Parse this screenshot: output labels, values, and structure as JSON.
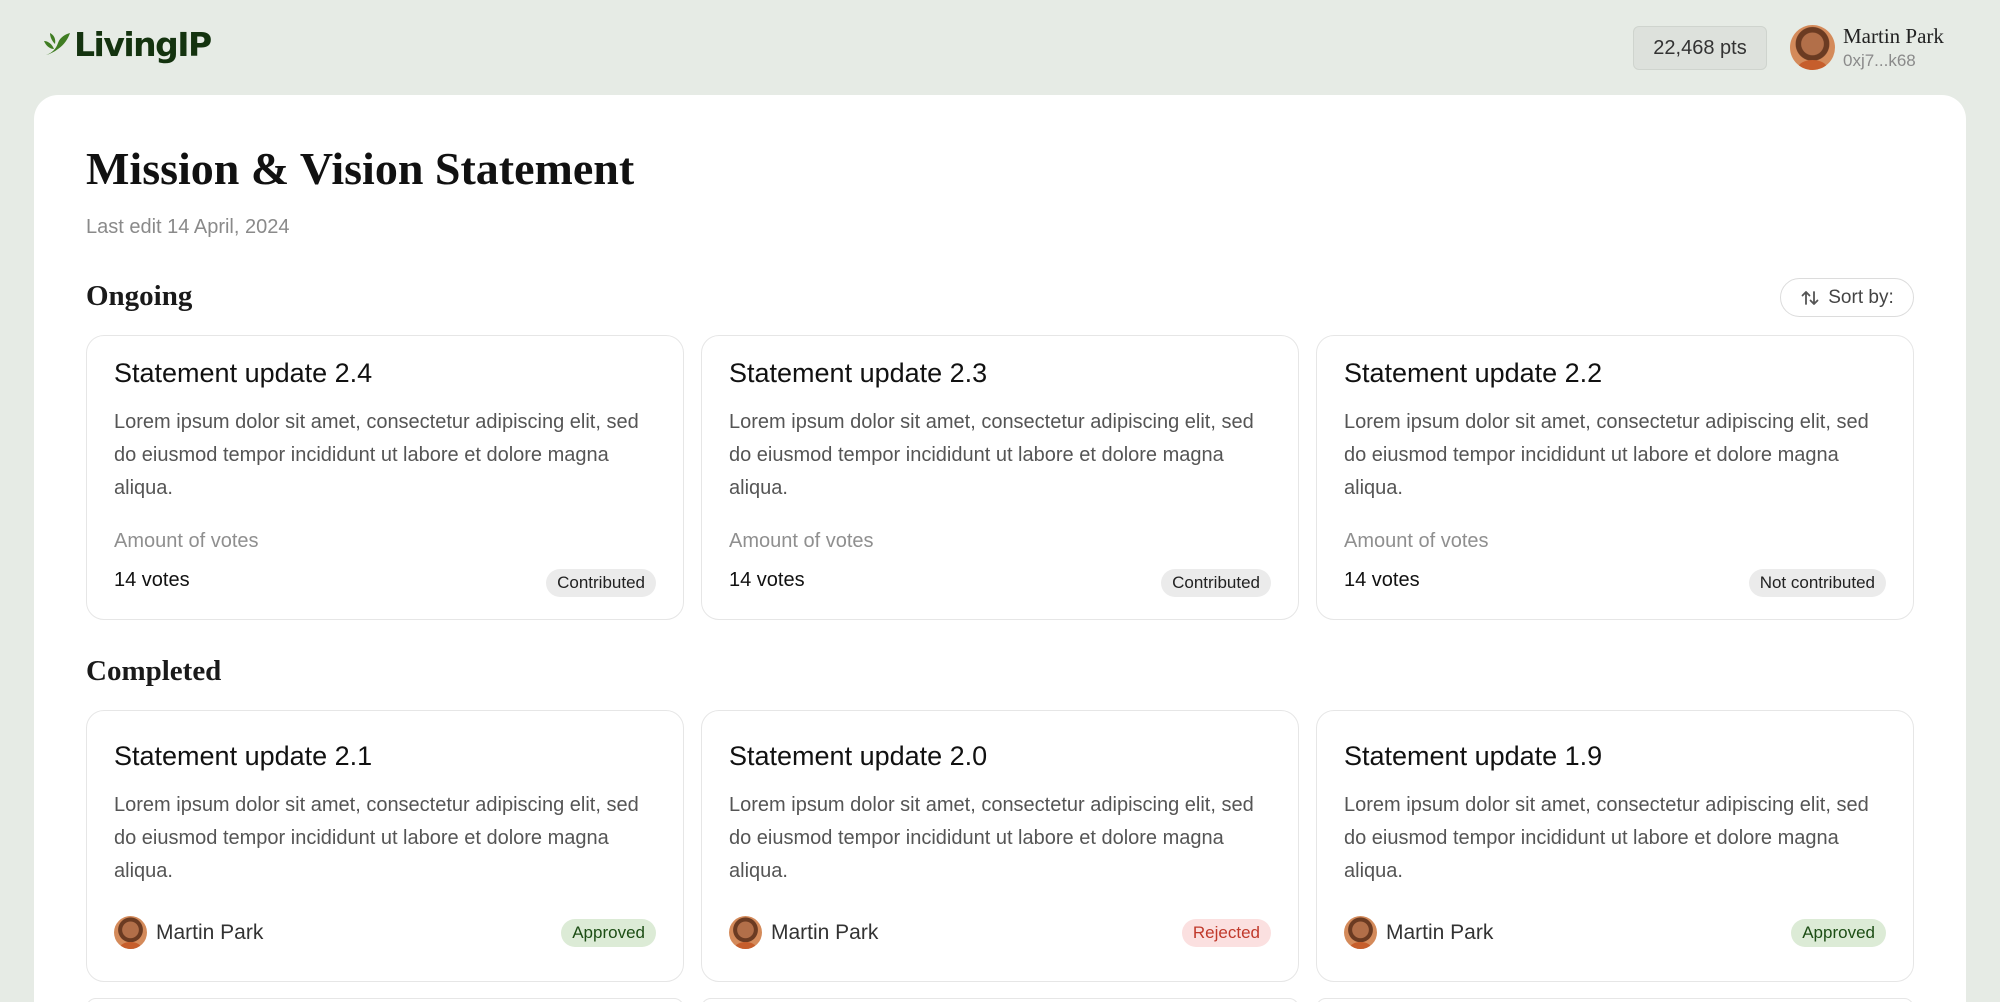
{
  "brand": {
    "name": "LivingIP",
    "color": "#14330f",
    "icon": "leaf-logo-icon"
  },
  "header": {
    "points": "22,468 pts",
    "user_name": "Martin Park",
    "user_address": "0xj7...k68"
  },
  "page": {
    "title": "Mission & Vision Statement",
    "last_edit": "Last edit 14 April, 2024"
  },
  "ongoing": {
    "heading": "Ongoing",
    "sort_label": "Sort by:",
    "cards": [
      {
        "title": "Statement update 2.4",
        "description": "Lorem ipsum dolor sit amet, consectetur adipiscing elit, sed do eiusmod tempor incididunt ut labore et dolore magna aliqua.",
        "votes_label": "Amount of votes",
        "votes": "14 votes",
        "status": "Contributed"
      },
      {
        "title": "Statement update 2.3",
        "description": "Lorem ipsum dolor sit amet, consectetur adipiscing elit, sed do eiusmod tempor incididunt ut labore et dolore magna aliqua.",
        "votes_label": "Amount of votes",
        "votes": "14 votes",
        "status": "Contributed"
      },
      {
        "title": "Statement update 2.2",
        "description": "Lorem ipsum dolor sit amet, consectetur adipiscing elit, sed do eiusmod tempor incididunt ut labore et dolore magna aliqua.",
        "votes_label": "Amount of votes",
        "votes": "14 votes",
        "status": "Not contributed"
      }
    ]
  },
  "completed": {
    "heading": "Completed",
    "cards": [
      {
        "title": "Statement update 2.1",
        "description": "Lorem ipsum dolor sit amet, consectetur adipiscing elit, sed do eiusmod tempor incididunt ut labore et dolore magna aliqua.",
        "author": "Martin Park",
        "status": "Approved"
      },
      {
        "title": "Statement update 2.0",
        "description": "Lorem ipsum dolor sit amet, consectetur adipiscing elit, sed do eiusmod tempor incididunt ut labore et dolore magna aliqua.",
        "author": "Martin Park",
        "status": "Rejected"
      },
      {
        "title": "Statement update 1.9",
        "description": "Lorem ipsum dolor sit amet, consectetur adipiscing elit, sed do eiusmod tempor incididunt ut labore et dolore magna aliqua.",
        "author": "Martin Park",
        "status": "Approved"
      }
    ]
  },
  "colors": {
    "background": "#e6ebe5",
    "approved_bg": "#dcebd6",
    "rejected_bg": "#fbe0e0",
    "rejected_text": "#c0392b"
  }
}
